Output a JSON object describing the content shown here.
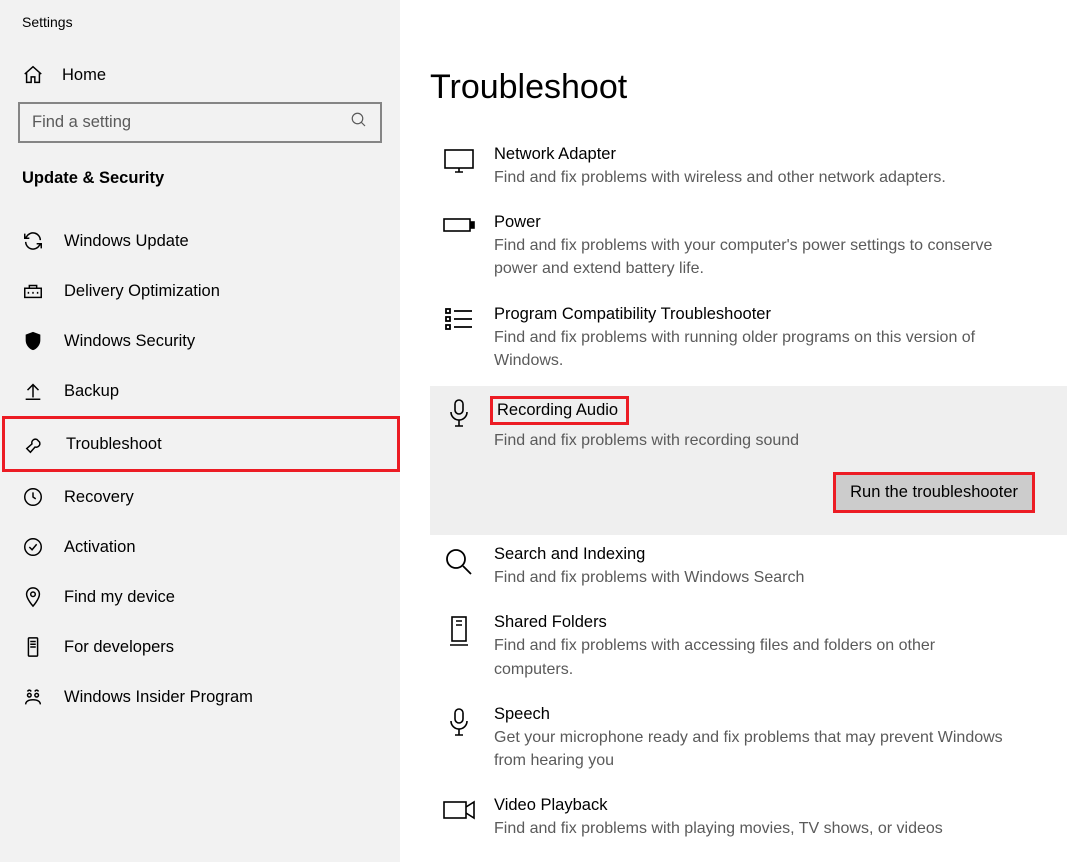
{
  "app_title": "Settings",
  "home_label": "Home",
  "search": {
    "placeholder": "Find a setting"
  },
  "section_header": "Update & Security",
  "sidebar": {
    "items": [
      {
        "label": "Windows Update"
      },
      {
        "label": "Delivery Optimization"
      },
      {
        "label": "Windows Security"
      },
      {
        "label": "Backup"
      },
      {
        "label": "Troubleshoot"
      },
      {
        "label": "Recovery"
      },
      {
        "label": "Activation"
      },
      {
        "label": "Find my device"
      },
      {
        "label": "For developers"
      },
      {
        "label": "Windows Insider Program"
      }
    ]
  },
  "page_title": "Troubleshoot",
  "run_button_label": "Run the troubleshooter",
  "troubleshooters": [
    {
      "title": "Network Adapter",
      "desc": "Find and fix problems with wireless and other network adapters."
    },
    {
      "title": "Power",
      "desc": "Find and fix problems with your computer's power settings to conserve power and extend battery life."
    },
    {
      "title": "Program Compatibility Troubleshooter",
      "desc": "Find and fix problems with running older programs on this version of Windows."
    },
    {
      "title": "Recording Audio",
      "desc": "Find and fix problems with recording sound"
    },
    {
      "title": "Search and Indexing",
      "desc": "Find and fix problems with Windows Search"
    },
    {
      "title": "Shared Folders",
      "desc": "Find and fix problems with accessing files and folders on other computers."
    },
    {
      "title": "Speech",
      "desc": "Get your microphone ready and fix problems that may prevent Windows from hearing you"
    },
    {
      "title": "Video Playback",
      "desc": "Find and fix problems with playing movies, TV shows, or videos"
    }
  ]
}
